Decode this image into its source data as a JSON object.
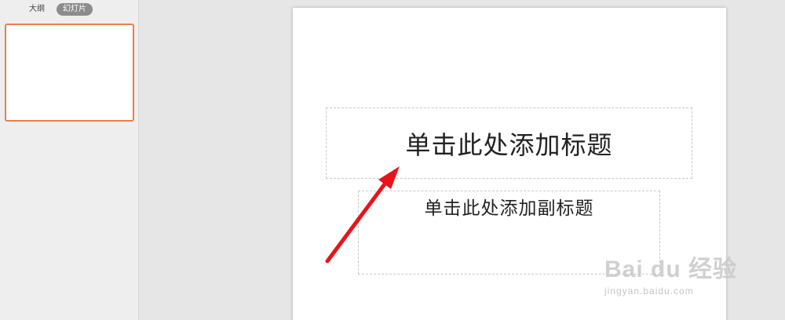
{
  "left_panel": {
    "tabs": [
      {
        "label": "大纲",
        "active": false
      },
      {
        "label": "幻灯片",
        "active": true
      }
    ],
    "selected_slide_border_color": "#e8804a"
  },
  "slide": {
    "title_placeholder": "单击此处添加标题",
    "subtitle_placeholder": "单击此处添加副标题"
  },
  "annotation": {
    "arrow_color": "#e8141b",
    "points_to": "title-placeholder"
  },
  "watermark": {
    "brand": "Bai du 经验",
    "url": "jingyan.baidu.com"
  }
}
